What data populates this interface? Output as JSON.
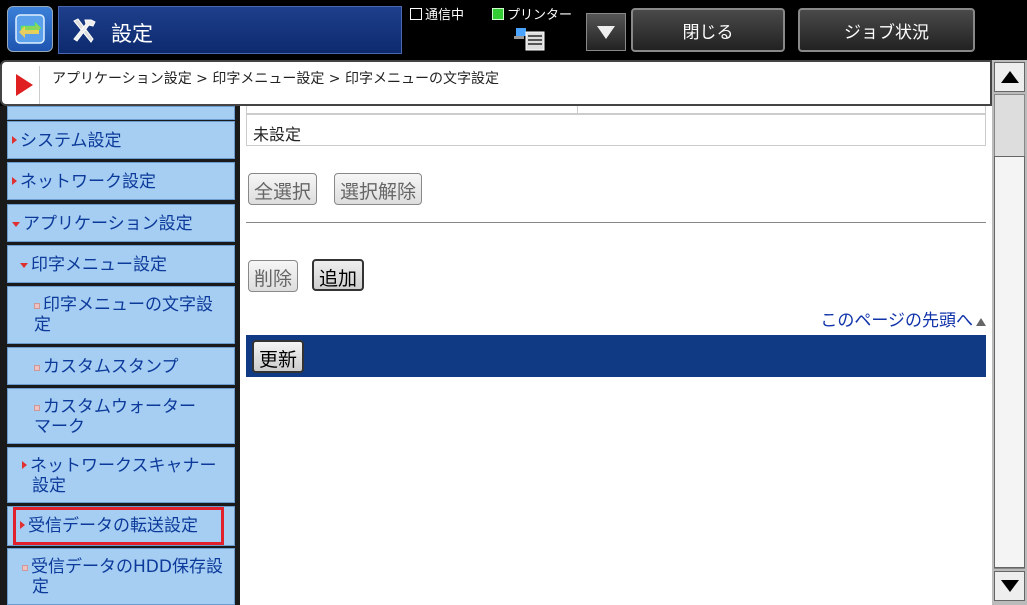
{
  "header": {
    "title": "設定",
    "status_label": "通信中",
    "printer_label": "プリンター",
    "close_label": "閉じる",
    "job_status_label": "ジョブ状況"
  },
  "breadcrumb": {
    "text": "アプリケーション設定 > 印字メニュー設定 > 印字メニューの文字設定"
  },
  "sidebar": {
    "items": [
      {
        "label": "システム設定",
        "marker": "right"
      },
      {
        "label": "ネットワーク設定",
        "marker": "right"
      },
      {
        "label": "アプリケーション設定",
        "marker": "down"
      },
      {
        "label": "印字メニュー設定",
        "marker": "down"
      },
      {
        "label": "印字メニューの文字設",
        "label2": "定",
        "marker": "square"
      },
      {
        "label": "カスタムスタンプ",
        "marker": "square"
      },
      {
        "label": "カスタムウォーター",
        "label2": "マーク",
        "marker": "square"
      },
      {
        "label": "ネットワークスキャナー",
        "label2": "設定",
        "marker": "right"
      },
      {
        "label": "受信データの転送設定",
        "marker": "right",
        "highlighted": true
      },
      {
        "label": "受信データのHDD保存設",
        "label2": "定",
        "marker": "square"
      }
    ]
  },
  "main": {
    "unset_value": "未設定",
    "select_all_label": "全選択",
    "deselect_label": "選択解除",
    "delete_label": "削除",
    "add_label": "追加",
    "page_top_link": "このページの先頭へ",
    "update_label": "更新"
  },
  "colors": {
    "sidebar_item_bg": "#a6cdf2",
    "sidebar_text": "#0b3a9a",
    "update_bar": "#103b84",
    "highlight_border": "#e0202a",
    "link": "#1133aa"
  }
}
